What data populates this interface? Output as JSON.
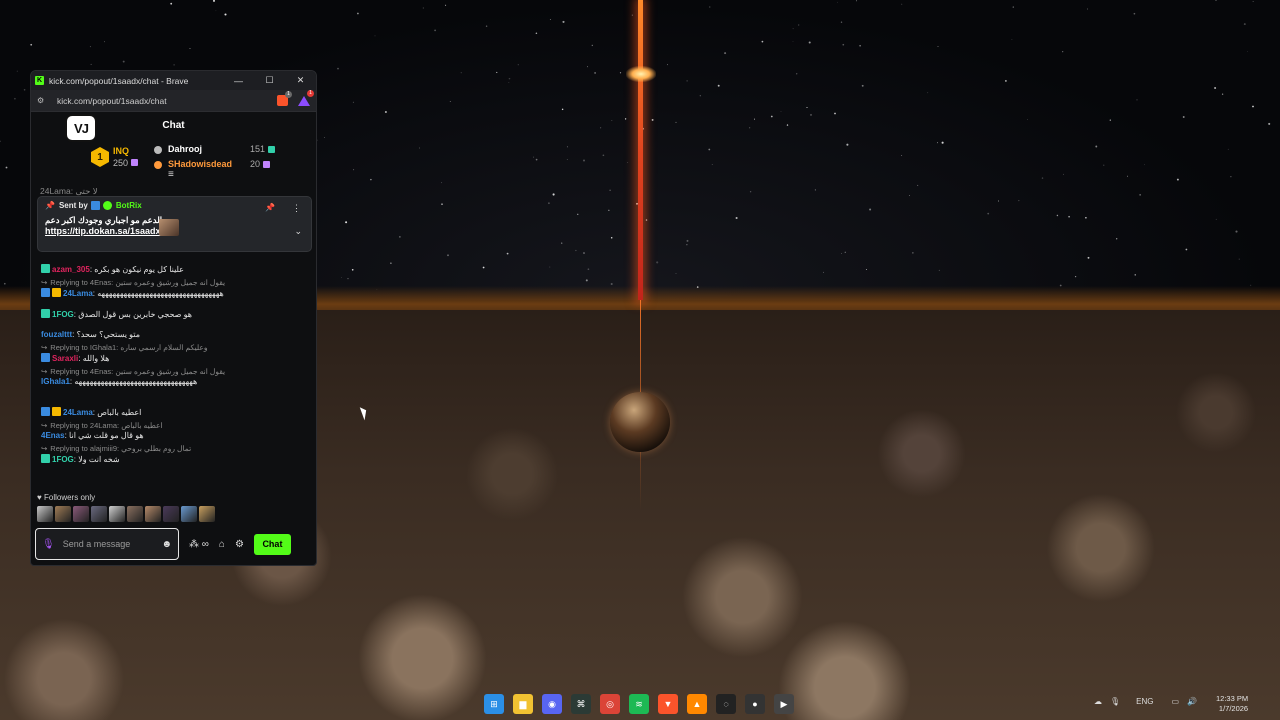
{
  "window": {
    "title": "kick.com/popout/1saadx/chat - Brave",
    "url": "kick.com/popout/1saadx/chat",
    "brave_badge": "1",
    "rewards_badge": "1"
  },
  "chat": {
    "header_title": "Chat",
    "logo_text": "VJ",
    "leaderboard": {
      "first": {
        "rank": "1",
        "name": "INQ",
        "count": "250"
      },
      "others": [
        {
          "name": "Dahrooj",
          "count": "151",
          "color": "#ffffff",
          "dot": "#bbbbbb",
          "gift_color": "#31d0aa"
        },
        {
          "name": "SHadowisdead",
          "count": "20",
          "color": "#ff9a3c",
          "dot": "#ff9a3c",
          "gift_color": "#c084fc"
        }
      ]
    },
    "partial_message": "24Lama: لا حتى",
    "pinned": {
      "sent_by": "Sent by",
      "bot_name": "BotRix",
      "text": "الدعم مو اجباري وجودك اكبر دعم",
      "link": "https://tip.dokan.sa/1saadx"
    },
    "messages": [
      {
        "user": "azam_305",
        "user_color": "#e0245e",
        "badge": "#31d0aa",
        "text": "علينا كل يوم نيكون هو بكره"
      },
      {
        "reply": "Replying to 4Enas: يقول انه جميل ورشيق وعمره ستين",
        "user": "24Lama",
        "user_color": "#3a8be0",
        "badges": [
          "#3a8be0",
          "#f5b800"
        ],
        "text": "هههههههههههههههههههههههههههههههههه"
      },
      {
        "user": "1FOG",
        "user_color": "#31d0aa",
        "badge": "#31d0aa",
        "text": "هو صحجي خابرين بس قول الصدق"
      },
      {
        "user": "fouzalttt",
        "user_color": "#3a8be0",
        "text": "متو يستحي؟ سحد؟"
      },
      {
        "reply": "Replying to IGhala1: وعليكم السلام ارسمي ساره",
        "user": "Saraxli",
        "user_color": "#e0245e",
        "badges": [
          "#3a8be0"
        ],
        "text": "هلا والله"
      },
      {
        "reply": "Replying to 4Enas: يقول انه جميل ورشيق وعمره ستين",
        "user": "IGhala1",
        "user_color": "#3a8be0",
        "text": "ههههههههههههههههههههههههههههههههه"
      },
      {
        "gap": true
      },
      {
        "user": "24Lama",
        "user_color": "#3a8be0",
        "badges": [
          "#3a8be0",
          "#f5b800"
        ],
        "text": "اعطيه بالباص"
      },
      {
        "reply": "Replying to 24Lama: اعطيه بالباص",
        "user": "4Enas",
        "user_color": "#3a8be0",
        "text": "هو قال مو قلت شي انا"
      },
      {
        "reply": "Replying to alajmiii9: تمال روم بطلي بروحي",
        "user": "1FOG",
        "user_color": "#31d0aa",
        "badges": [
          "#31d0aa"
        ],
        "text": "شخه انت ولا"
      }
    ],
    "followers_only": "Followers only",
    "follower_avatars": [
      "#c9c9c9",
      "#a07c56",
      "#8a5a7a",
      "#6a6a80",
      "#d0d0d0",
      "#8a7060",
      "#b58a6a",
      "#4a3a5a",
      "#6a9ad0",
      "#c8a060"
    ],
    "input_placeholder": "Send a message",
    "chat_button": "Chat",
    "emote_label": "∞"
  },
  "taskbar": {
    "apps": [
      {
        "name": "windows-start-icon",
        "color": "#2b8fe6",
        "glyph": "⊞"
      },
      {
        "name": "file-explorer-icon",
        "color": "#f1c232",
        "glyph": "▆"
      },
      {
        "name": "discord-icon",
        "color": "#5865f2",
        "glyph": "◉"
      },
      {
        "name": "terminal-icon",
        "color": "#2b3a35",
        "glyph": "⌘"
      },
      {
        "name": "chrome-icon",
        "color": "#db4437",
        "glyph": "◎"
      },
      {
        "name": "spotify-icon",
        "color": "#1db954",
        "glyph": "≋"
      },
      {
        "name": "brave-icon",
        "color": "#fb542b",
        "glyph": "▼"
      },
      {
        "name": "vlc-icon",
        "color": "#ff8800",
        "glyph": "▲"
      },
      {
        "name": "obs-icon",
        "color": "#222222",
        "glyph": "◌"
      },
      {
        "name": "recorder-icon",
        "color": "#333333",
        "glyph": "●"
      },
      {
        "name": "media-player-icon",
        "color": "#444444",
        "glyph": "▶"
      }
    ],
    "lang": "ENG",
    "time": "12:33 PM",
    "date": "1/7/2026"
  }
}
